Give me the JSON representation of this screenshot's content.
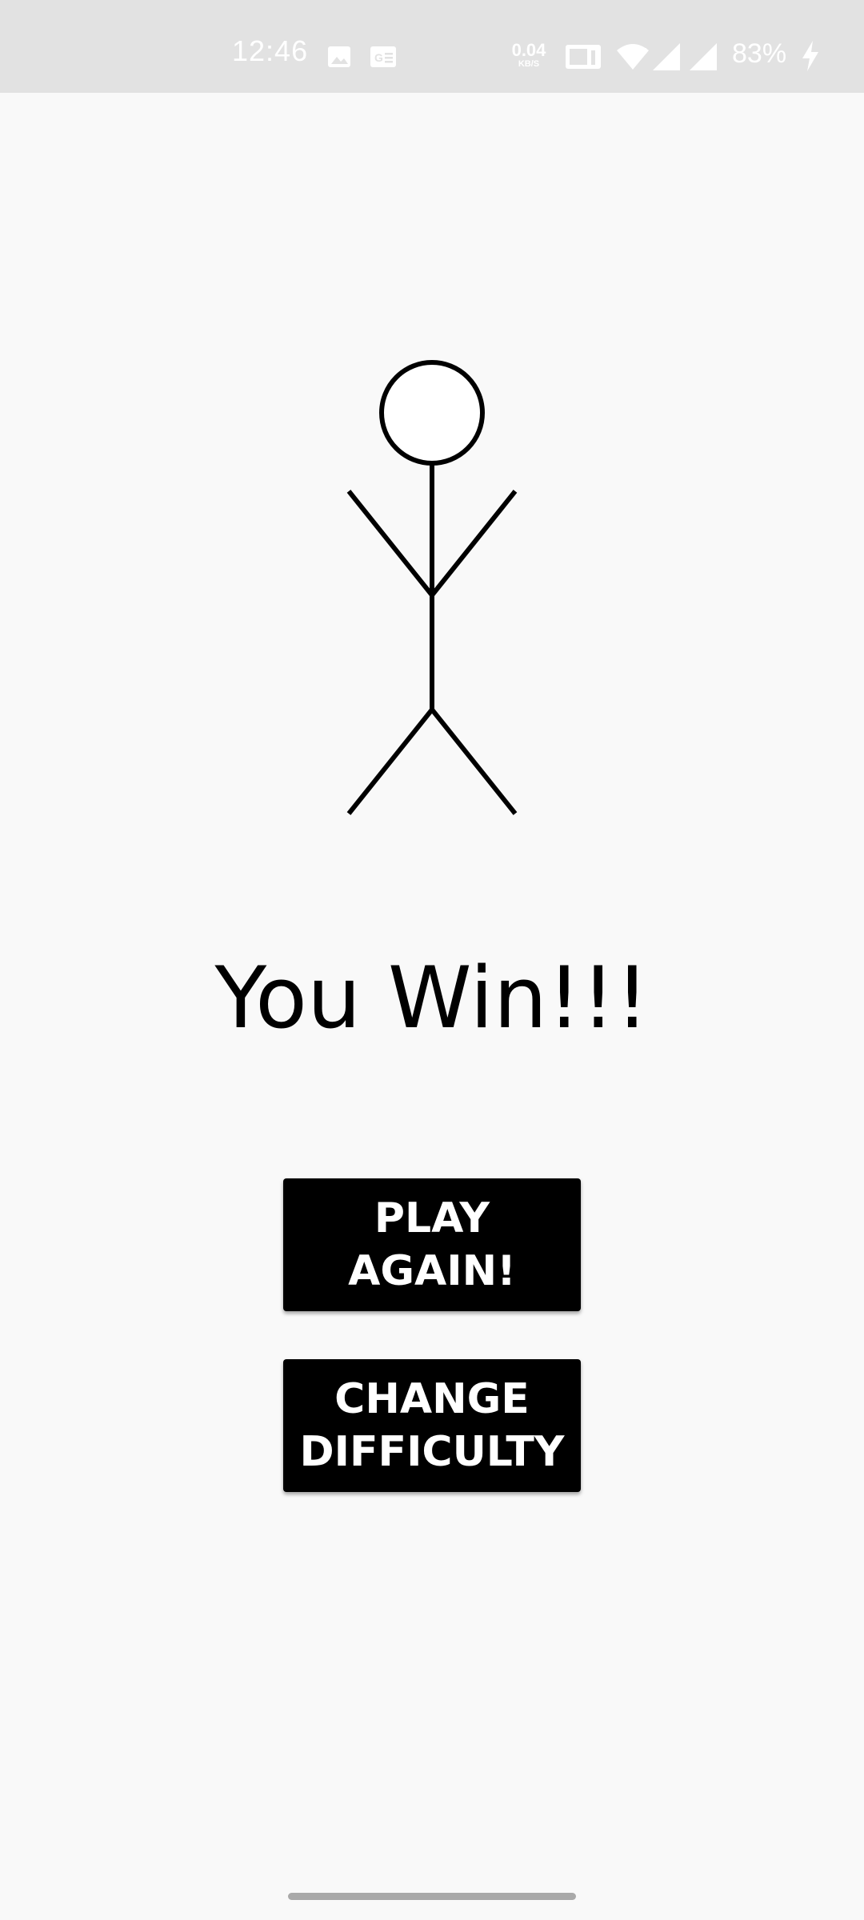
{
  "status_bar": {
    "time": "12:46",
    "net_speed_value": "0.04",
    "net_speed_unit": "KB/S",
    "battery": "83%",
    "icons": [
      "image-icon",
      "sim-card-icon",
      "volte-icon",
      "wifi-icon",
      "signal-icon",
      "signal-icon",
      "charging-icon"
    ]
  },
  "result": {
    "message": "You Win!!!"
  },
  "buttons": {
    "play_again": "PLAY\nAGAIN!",
    "change_difficulty": "CHANGE\nDIFFICULTY"
  },
  "colors": {
    "background": "#f9f9f9",
    "status_bar": "#e2e2e2",
    "button": "#000000",
    "button_text": "#ffffff"
  }
}
